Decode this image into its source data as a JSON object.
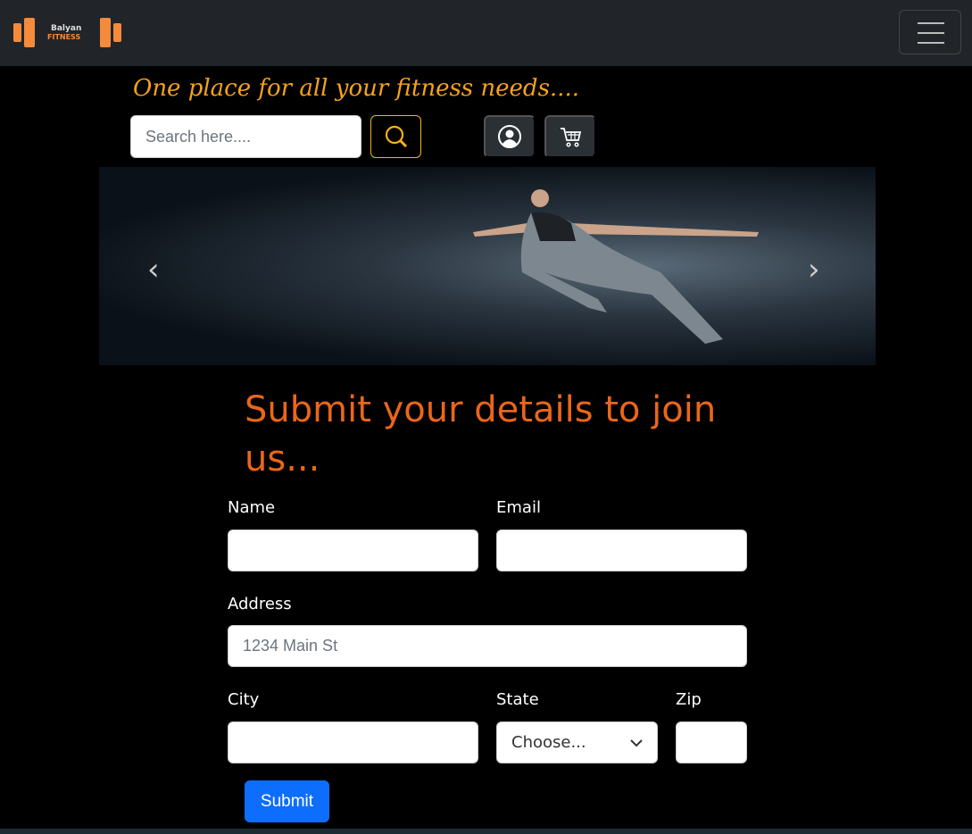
{
  "nav": {
    "logo_line1": "Balyan",
    "logo_line2": "FITNESS"
  },
  "tagline": "One place for all your fitness needs....",
  "search": {
    "placeholder": "Search here...."
  },
  "form": {
    "title": "Submit your details to join us...",
    "name_label": "Name",
    "email_label": "Email",
    "address_label": "Address",
    "address_placeholder": "1234 Main St",
    "city_label": "City",
    "state_label": "State",
    "state_selected": "Choose...",
    "zip_label": "Zip",
    "submit_label": "Submit"
  }
}
